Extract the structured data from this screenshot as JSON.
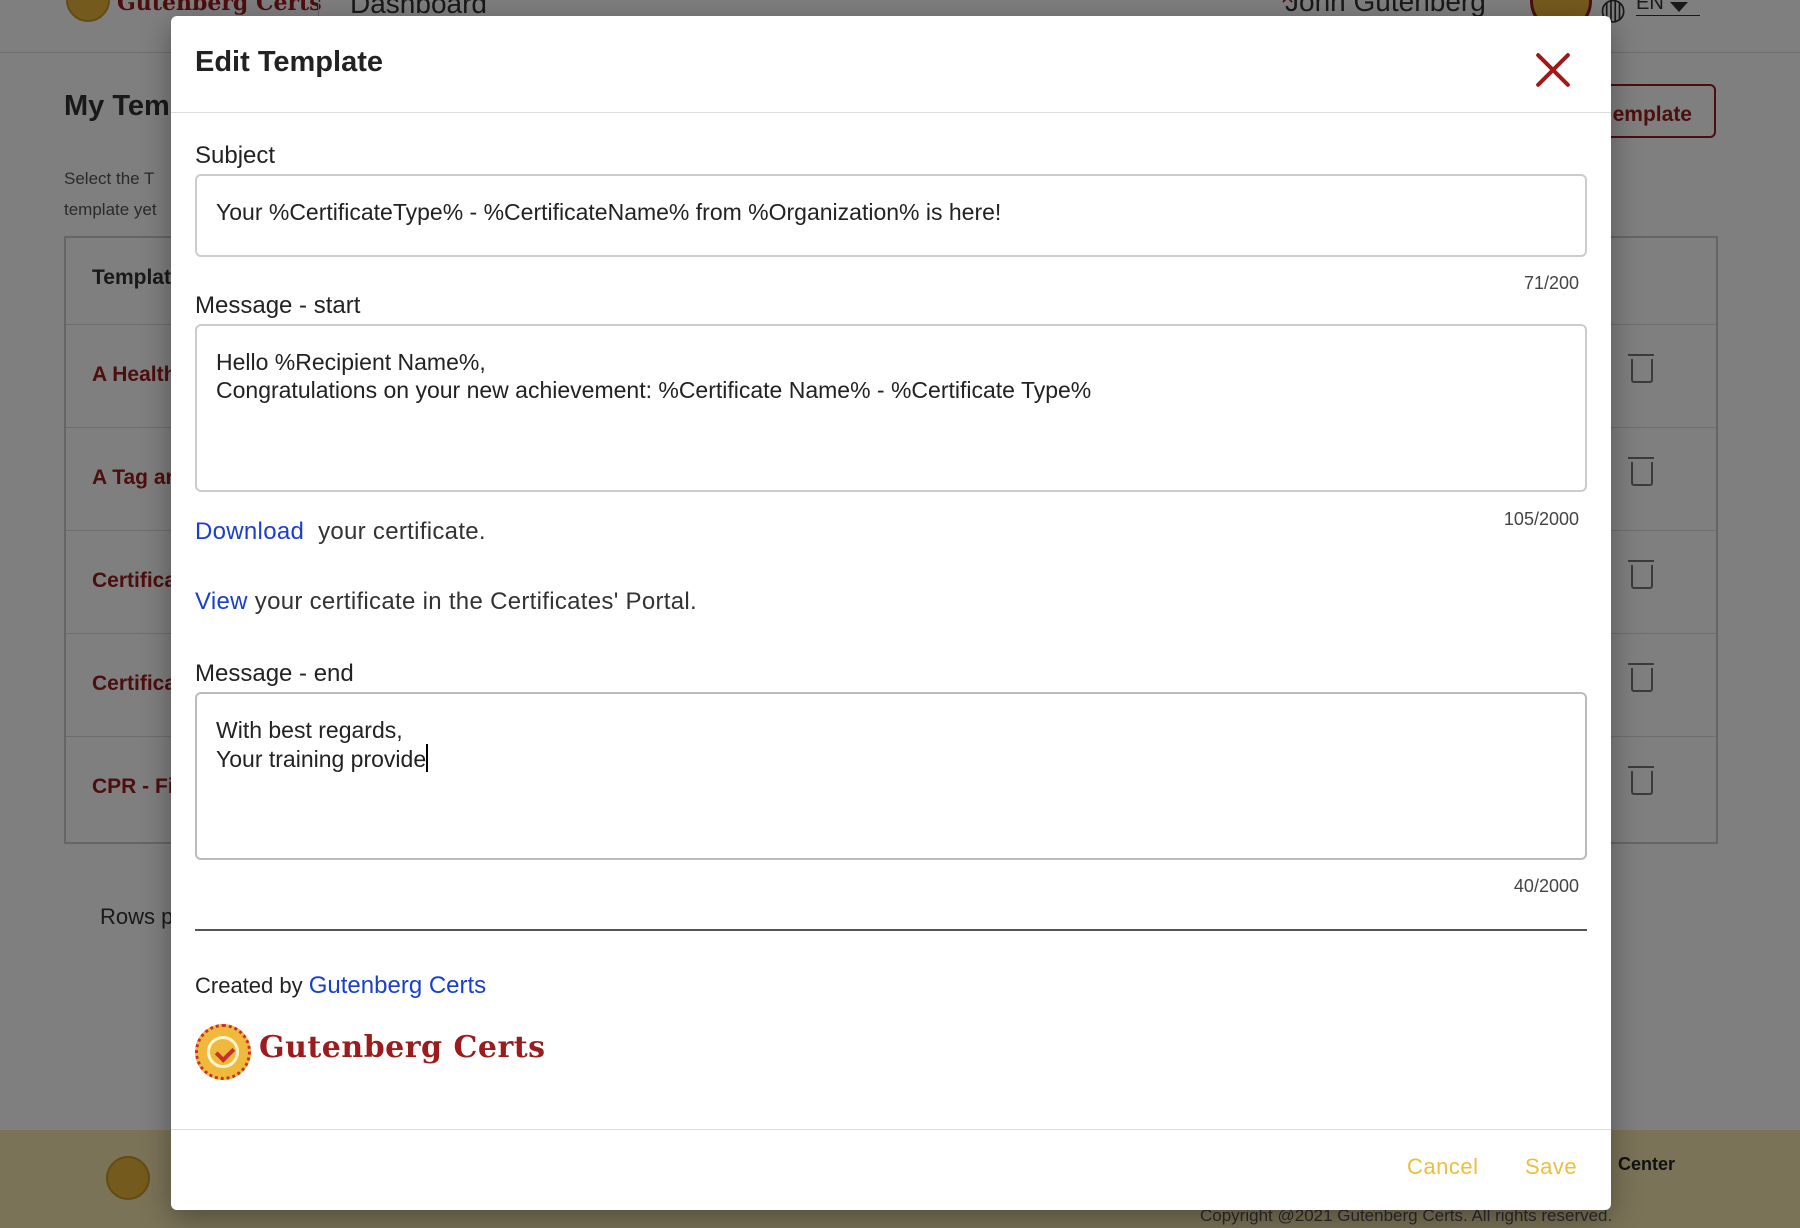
{
  "background": {
    "brand": "Gutenberg Certs",
    "page_title": "Dashboard",
    "user_name": "John Gutenberg",
    "language": "EN",
    "section_title": "My Tem",
    "section_desc_1": "Select the T",
    "section_desc_2": "template yet",
    "add_button": "emplate",
    "table_header": "Templat",
    "rows": [
      "A Health",
      "A Tag an",
      "Certifica",
      "Certifica",
      "CPR - Fi"
    ],
    "rows_per_page": "Rows p",
    "footer_help": "Center",
    "footer_copyright": "Copyright @2021 Gutenberg Certs. All rights reserved."
  },
  "modal": {
    "title": "Edit Template",
    "subject": {
      "label": "Subject",
      "value": "Your %CertificateType% - %CertificateName% from %Organization% is here!",
      "counter": "71/200"
    },
    "message_start": {
      "label": "Message - start",
      "lines": [
        "Hello %Recipient Name%,",
        "Congratulations on your new achievement: %Certificate Name% - %Certificate Type%"
      ],
      "counter": "105/2000"
    },
    "download_line": {
      "link": "Download",
      "text": "your certificate."
    },
    "view_line": {
      "link": "View",
      "text": "your certificate in the Certificates' Portal."
    },
    "message_end": {
      "label": "Message - end",
      "lines": [
        "With best regards,",
        "Your training provide"
      ],
      "counter": "40/2000"
    },
    "created_by": {
      "prefix": "Created by",
      "link": "Gutenberg Certs"
    },
    "brand_name": "Gutenberg Certs",
    "cancel_label": "Cancel",
    "save_label": "Save"
  },
  "colors": {
    "brand_red": "#9b1c1c",
    "close_red": "#a01818",
    "link_blue": "#1a3fcc",
    "action_yellow": "#ebbf3c",
    "footer_bg": "#f7e7b1"
  },
  "icons": [
    "close-icon",
    "trash-icon",
    "globe-icon",
    "avatar",
    "chevron-down-icon",
    "seal-logo-icon"
  ]
}
